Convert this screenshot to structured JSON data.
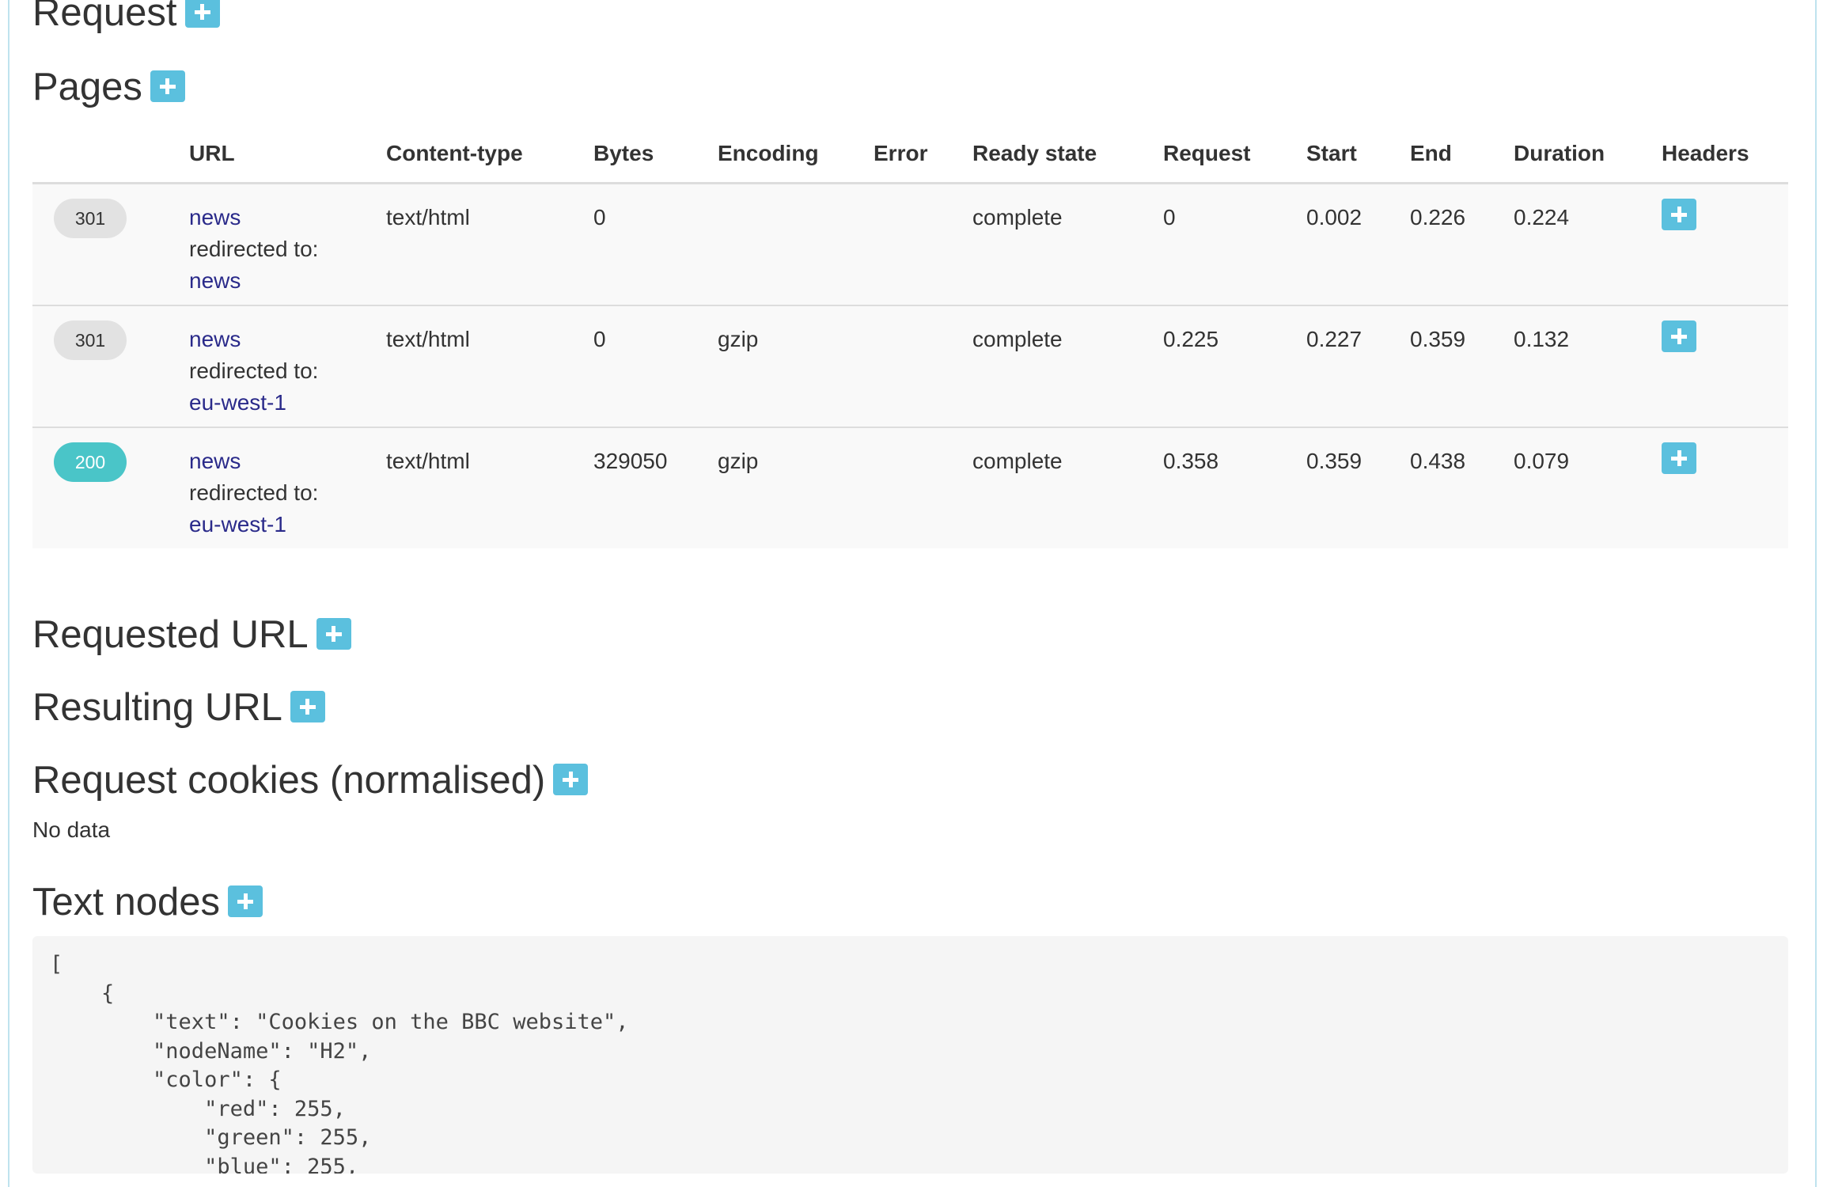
{
  "sections": {
    "request": "Request",
    "pages": "Pages",
    "requested_url": "Requested URL",
    "resulting_url": "Resulting URL",
    "request_cookies": "Request cookies (normalised)",
    "text_nodes": "Text nodes"
  },
  "no_data": "No data",
  "table": {
    "headers": [
      "",
      "URL",
      "Content-type",
      "Bytes",
      "Encoding",
      "Error",
      "Ready state",
      "Request",
      "Start",
      "End",
      "Duration",
      "Headers"
    ],
    "redirect_label": "redirected to:",
    "rows": [
      {
        "status": "301",
        "url": "news",
        "redirect": "news",
        "content_type": "text/html",
        "bytes": "0",
        "encoding": "",
        "error": "",
        "ready_state": "complete",
        "request": "0",
        "start": "0.002",
        "end": "0.226",
        "duration": "0.224"
      },
      {
        "status": "301",
        "url": "news",
        "redirect": "eu-west-1",
        "content_type": "text/html",
        "bytes": "0",
        "encoding": "gzip",
        "error": "",
        "ready_state": "complete",
        "request": "0.225",
        "start": "0.227",
        "end": "0.359",
        "duration": "0.132"
      },
      {
        "status": "200",
        "url": "news",
        "redirect": "eu-west-1",
        "content_type": "text/html",
        "bytes": "329050",
        "encoding": "gzip",
        "error": "",
        "ready_state": "complete",
        "request": "0.358",
        "start": "0.359",
        "end": "0.438",
        "duration": "0.079"
      }
    ]
  },
  "code": {
    "lines": [
      "[",
      "    {",
      "        \"text\": \"Cookies on the BBC website\",",
      "        \"nodeName\": \"H2\",",
      "        \"color\": {",
      "            \"red\": 255,",
      "            \"green\": 255,",
      "            \"blue\": 255,"
    ]
  },
  "colors": {
    "accent": "#5bc0de",
    "status_ok": "#4ac5c8",
    "status_redirect": "#e2e2e2",
    "link": "#2a2a8a"
  }
}
